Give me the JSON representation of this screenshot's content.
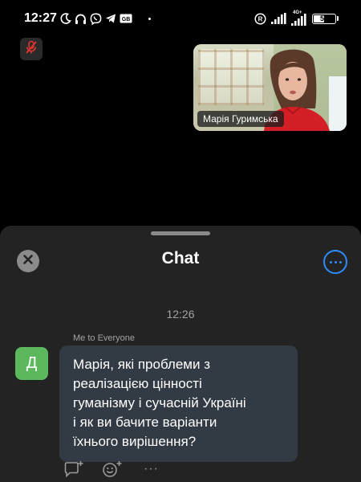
{
  "status_bar": {
    "time": "12:27",
    "battery_level": "56",
    "network_label": "4G+",
    "icons_left": [
      "moon-icon",
      "headphones-icon",
      "viber-icon",
      "telegram-icon",
      "gb-icon"
    ],
    "icons_right": [
      "registered-icon",
      "signal-icon",
      "signal-4g-icon",
      "battery-icon"
    ]
  },
  "mute_button": {
    "icon": "mic-off-icon",
    "color": "#e0362f"
  },
  "video_tile": {
    "participant_name": "Марія Гуримська"
  },
  "chat": {
    "title": "Chat",
    "timestamp": "12:26",
    "sender_line": "Me to Everyone",
    "avatar_letter": "Д",
    "avatar_color": "#5cb85c",
    "message_lines": [
      "Марія, які проблеми з",
      "реалізацією цінності",
      "гуманізму і сучасній Україні",
      "і як ви бачите варіанти",
      "їхнього вирішення?"
    ],
    "reaction_icons": [
      "reply-icon",
      "add-emoji-icon",
      "more-actions-icon"
    ],
    "more_actions_label": "···",
    "accent_color": "#2d8cff"
  }
}
